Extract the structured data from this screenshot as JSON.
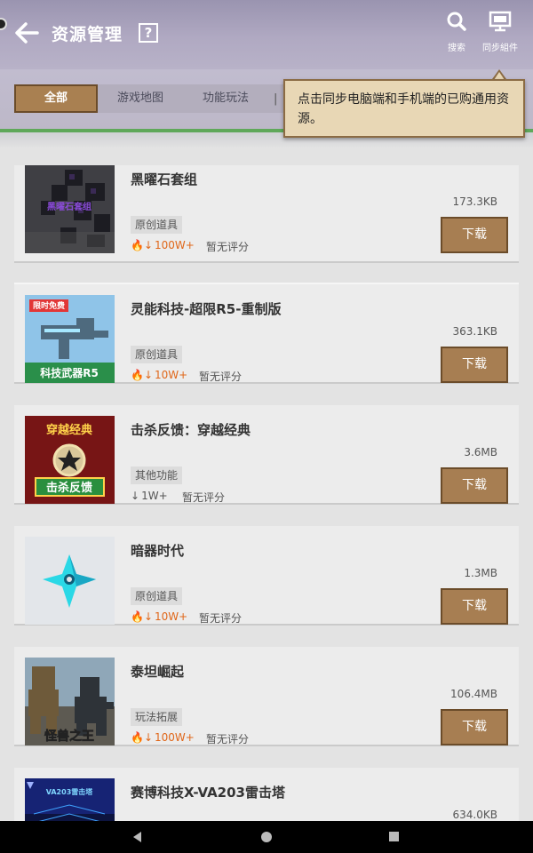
{
  "header": {
    "title": "资源管理",
    "help_label": "?",
    "search_label": "搜索",
    "sync_label": "同步組件"
  },
  "tabs": [
    {
      "label": "全部",
      "active": true
    },
    {
      "label": "游戏地图",
      "active": false
    },
    {
      "label": "功能玩法",
      "active": false
    }
  ],
  "tooltip": {
    "text": "点击同步电脑端和手机端的已购通用资源。"
  },
  "resources": [
    {
      "name": "黑曜石套组",
      "tag": "原创道具",
      "downloads": "100W+",
      "hot": true,
      "rating": "暂无评分",
      "size": "173.3KB",
      "button": "下载",
      "thumb_text": "黑曜石套组"
    },
    {
      "name": "灵能科技-超限R5-重制版",
      "tag": "原创道具",
      "downloads": "10W+",
      "hot": true,
      "rating": "暂无评分",
      "size": "363.1KB",
      "button": "下载",
      "thumb_text": "科技武器R5",
      "thumb_badge": "限时免费"
    },
    {
      "name": "击杀反馈：穿越经典",
      "tag": "其他功能",
      "downloads": "1W+",
      "hot": false,
      "rating": "暂无评分",
      "size": "3.6MB",
      "button": "下载",
      "thumb_text": "击杀反馈",
      "thumb_badge": "穿越经典"
    },
    {
      "name": "暗器时代",
      "tag": "原创道具",
      "downloads": "10W+",
      "hot": true,
      "rating": "暂无评分",
      "size": "1.3MB",
      "button": "下载"
    },
    {
      "name": "泰坦崛起",
      "tag": "玩法拓展",
      "downloads": "100W+",
      "hot": true,
      "rating": "暂无评分",
      "size": "106.4MB",
      "button": "下载",
      "thumb_text": "怪兽之王"
    },
    {
      "name": "赛博科技X-VA203雷击塔",
      "size": "634.0KB",
      "thumb_text": "VA203雷击塔"
    }
  ],
  "colors": {
    "accent": "#a77e52",
    "hot": "#e0671a",
    "header": "#9a94b0"
  }
}
